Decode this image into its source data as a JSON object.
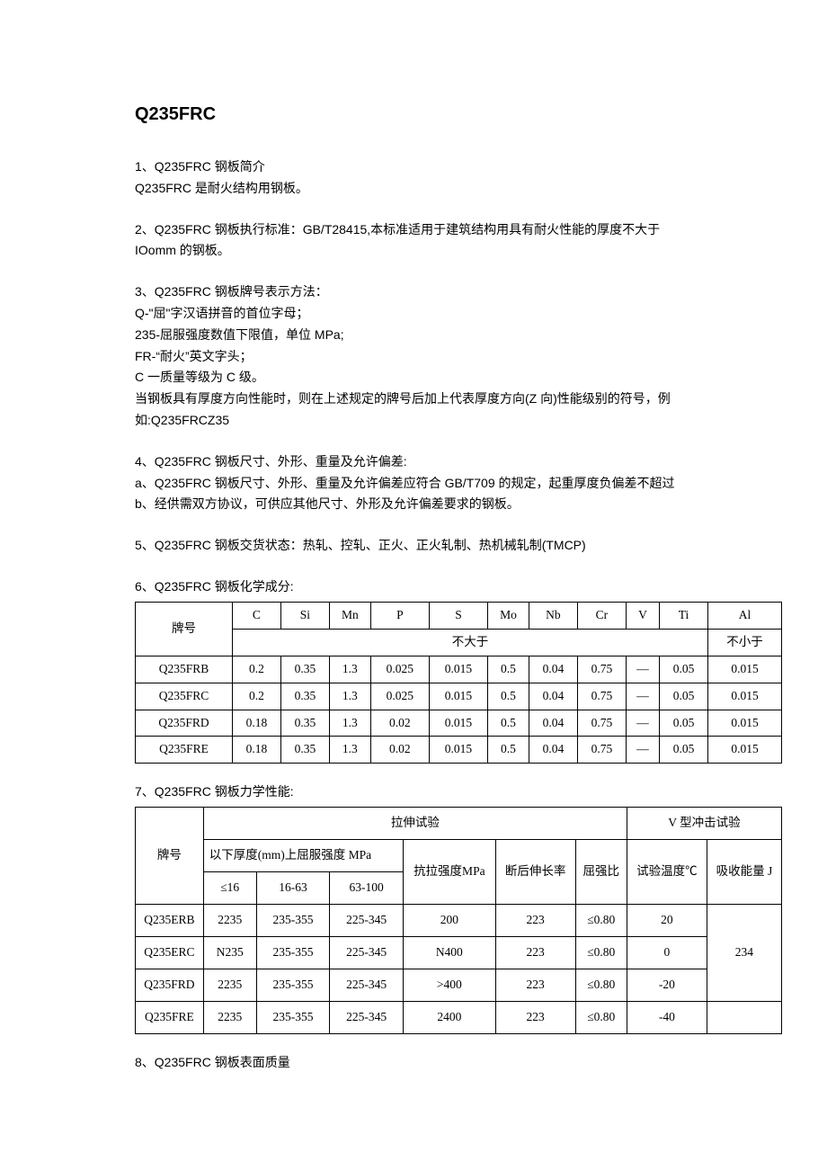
{
  "title": "Q235FRC",
  "s1": {
    "h": "1、Q235FRC 钢板简介",
    "p": "Q235FRC 是耐火结构用钢板。"
  },
  "s2": "2、Q235FRC 钢板执行标准：GB/T28415,本标准适用于建筑结构用具有耐火性能的厚度不大于 IOomm 的钢板。",
  "s3": {
    "h": "3、Q235FRC 钢板牌号表示方法：",
    "l1": "Q-\"屈\"字汉语拼音的首位字母；",
    "l2": "235-屈服强度数值下限值，单位 MPa;",
    "l3": "FR-“耐火”英文字头；",
    "l4": "C 一质量等级为 C 级。",
    "l5": "当钢板具有厚度方向性能时，则在上述规定的牌号后加上代表厚度方向(Z 向)性能级别的符号，例",
    "l6": "如:Q235FRCZ35"
  },
  "s4": {
    "h": "4、Q235FRC 钢板尺寸、外形、重量及允许偏差:",
    "a": "a、Q235FRC 钢板尺寸、外形、重量及允许偏差应符合 GB/T709 的规定，起重厚度负偏差不超过",
    "b": "b、经供需双方协议，可供应其他尺寸、外形及允许偏差要求的钢板。"
  },
  "s5": "5、Q235FRC 钢板交货状态：热轧、控轧、正火、正火轧制、热机械轧制(TMCP)",
  "s6h": "6、Q235FRC 钢板化学成分:",
  "chem": {
    "headers": [
      "牌号",
      "C",
      "Si",
      "Mn",
      "P",
      "S",
      "Mo",
      "Nb",
      "Cr",
      "V",
      "Ti",
      "Al"
    ],
    "sub1": "不大于",
    "sub2": "不小于",
    "rows": [
      [
        "Q235FRB",
        "0.2",
        "0.35",
        "1.3",
        "0.025",
        "0.015",
        "0.5",
        "0.04",
        "0.75",
        "—",
        "0.05",
        "0.015"
      ],
      [
        "Q235FRC",
        "0.2",
        "0.35",
        "1.3",
        "0.025",
        "0.015",
        "0.5",
        "0.04",
        "0.75",
        "—",
        "0.05",
        "0.015"
      ],
      [
        "Q235FRD",
        "0.18",
        "0.35",
        "1.3",
        "0.02",
        "0.015",
        "0.5",
        "0.04",
        "0.75",
        "—",
        "0.05",
        "0.015"
      ],
      [
        "Q235FRE",
        "0.18",
        "0.35",
        "1.3",
        "0.02",
        "0.015",
        "0.5",
        "0.04",
        "0.75",
        "—",
        "0.05",
        "0.015"
      ]
    ]
  },
  "s7h": "7、Q235FRC 钢板力学性能:",
  "mech": {
    "h_grade": "牌号",
    "h_tensile": "拉伸试验",
    "h_impact": "V 型冲击试验",
    "h_yield": "以下厚度(mm)上屈服强度 MPa",
    "h_tstrength": "抗拉强度MPa",
    "h_elong": "断后伸长率",
    "h_ratio": "屈强比",
    "h_temp": "试验温度℃",
    "h_energy": "吸收能量 J",
    "h_t1": "≤16",
    "h_t2": "16-63",
    "h_t3": "63-100",
    "rows": [
      [
        "Q235ERB",
        "2235",
        "235-355",
        "225-345",
        "200",
        "223",
        "≤0.80",
        "20"
      ],
      [
        "Q235ERC",
        "N235",
        "235-355",
        "225-345",
        "N400",
        "223",
        "≤0.80",
        "0"
      ],
      [
        "Q235FRD",
        "2235",
        "235-355",
        "225-345",
        ">400",
        "223",
        "≤0.80",
        "-20"
      ],
      [
        "Q235FRE",
        "2235",
        "235-355",
        "225-345",
        "2400",
        "223",
        "≤0.80",
        "-40"
      ]
    ],
    "energy": "234"
  },
  "s8": "8、Q235FRC 钢板表面质量"
}
